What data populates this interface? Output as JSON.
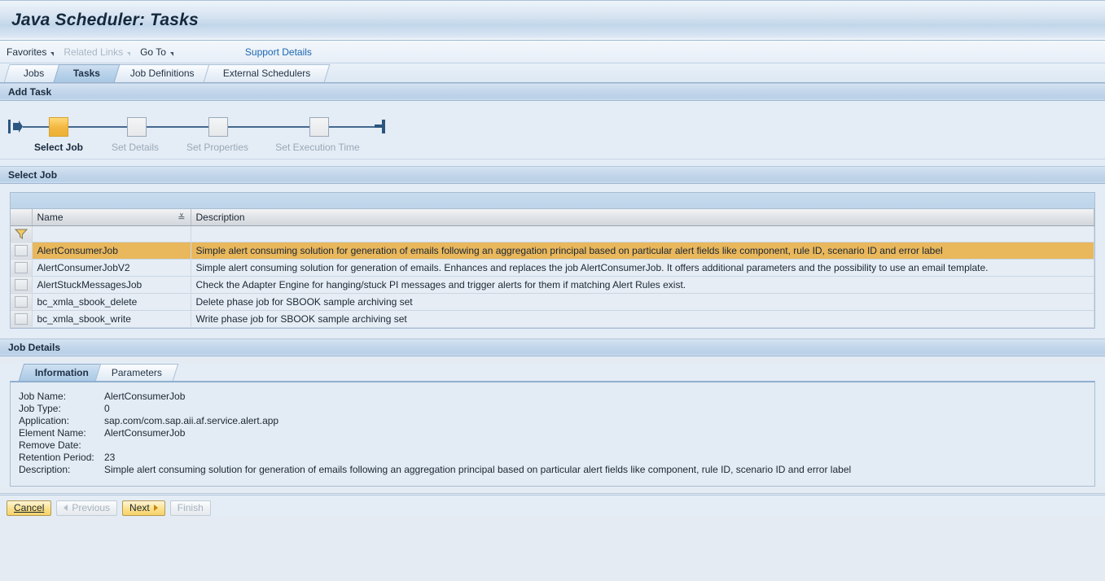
{
  "window": {
    "title": "Java Scheduler: Tasks"
  },
  "menubar": {
    "items": [
      {
        "label": "Favorites",
        "disabled": false,
        "dropdown": true
      },
      {
        "label": "Related Links",
        "disabled": true,
        "dropdown": true
      },
      {
        "label": "Go To",
        "disabled": false,
        "dropdown": true
      }
    ],
    "support_link": "Support Details",
    "link_color": "#1a66b0"
  },
  "tabs": [
    {
      "label": "Jobs",
      "active": false
    },
    {
      "label": "Tasks",
      "active": true
    },
    {
      "label": "Job Definitions",
      "active": false
    },
    {
      "label": "External Schedulers",
      "active": false
    }
  ],
  "wizard": {
    "header": "Add Task",
    "active_color": "#f3b63f",
    "steps": [
      {
        "label": "Select Job",
        "active": true
      },
      {
        "label": "Set  Details",
        "active": false
      },
      {
        "label": "Set Properties",
        "active": false
      },
      {
        "label": "Set Execution Time",
        "active": false
      }
    ]
  },
  "select_job": {
    "header": "Select Job",
    "columns": [
      "Name",
      "Description"
    ],
    "sort_column": "Name",
    "sort_direction": "ascending",
    "filter_row": {
      "name_value": "",
      "description_value": ""
    },
    "selected_row_color": "#e9b75c",
    "rows": [
      {
        "name": "AlertConsumerJob",
        "description": "Simple alert consuming solution for generation of emails following an aggregation principal based on particular alert fields like component, rule ID, scenario ID and error label",
        "selected": true
      },
      {
        "name": "AlertConsumerJobV2",
        "description": "Simple alert consuming solution for generation of emails. Enhances and replaces the job AlertConsumerJob. It offers additional parameters and the possibility to use an email template.",
        "selected": false
      },
      {
        "name": "AlertStuckMessagesJob",
        "description": "Check the Adapter Engine for hanging/stuck PI messages and trigger alerts for them if matching Alert Rules exist.",
        "selected": false
      },
      {
        "name": "bc_xmla_sbook_delete",
        "description": "Delete phase job for SBOOK sample archiving set",
        "selected": false
      },
      {
        "name": "bc_xmla_sbook_write",
        "description": "Write phase job for SBOOK sample archiving set",
        "selected": false
      }
    ]
  },
  "job_details": {
    "header": "Job Details",
    "tabs": [
      {
        "label": "Information",
        "active": true
      },
      {
        "label": "Parameters",
        "active": false
      }
    ],
    "fields": [
      {
        "key": "Job Name:",
        "value": "AlertConsumerJob"
      },
      {
        "key": "Job Type:",
        "value": "0"
      },
      {
        "key": "Application:",
        "value": "sap.com/com.sap.aii.af.service.alert.app"
      },
      {
        "key": "Element Name:",
        "value": "AlertConsumerJob"
      },
      {
        "key": "Remove Date:",
        "value": ""
      },
      {
        "key": "Retention Period:",
        "value": "23"
      },
      {
        "key": "Description:",
        "value": "Simple alert consuming solution for generation of emails following an aggregation principal based on particular alert fields like component, rule ID, scenario ID and error label"
      }
    ]
  },
  "footer": {
    "buttons": [
      {
        "label": "Cancel",
        "style": "primary",
        "disabled": false,
        "focused": true,
        "arrow": "none"
      },
      {
        "label": "Previous",
        "style": "default",
        "disabled": true,
        "focused": false,
        "arrow": "left"
      },
      {
        "label": "Next",
        "style": "primary",
        "disabled": false,
        "focused": false,
        "arrow": "right"
      },
      {
        "label": "Finish",
        "style": "default",
        "disabled": true,
        "focused": false,
        "arrow": "none"
      }
    ]
  }
}
